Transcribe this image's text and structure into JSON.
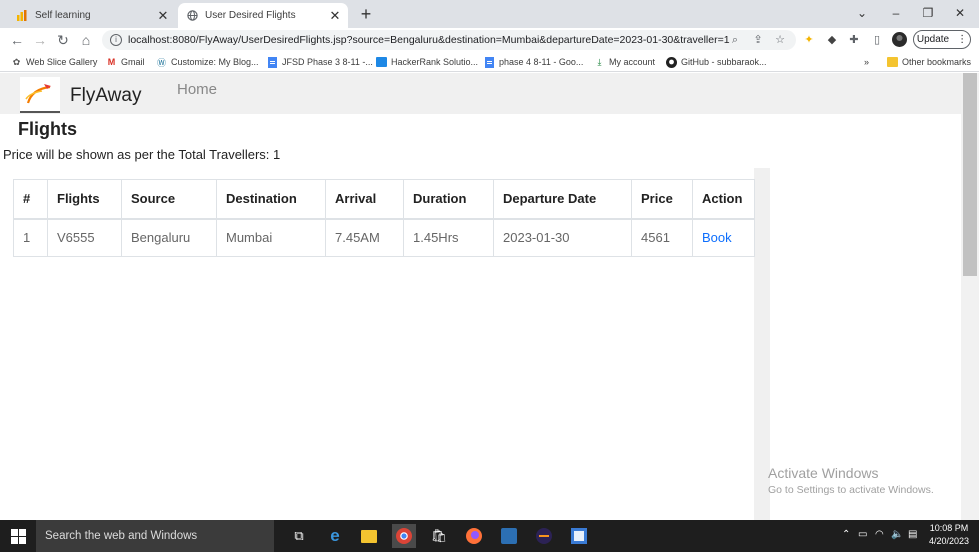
{
  "browser": {
    "tabs": [
      {
        "title": "Self learning",
        "icon": "chart-bars-icon",
        "active": false
      },
      {
        "title": "User Desired Flights",
        "icon": "globe-icon",
        "active": true
      }
    ],
    "new_tab": "+",
    "window_controls": {
      "dropdown": "⌄",
      "minimize": "–",
      "restore": "❐",
      "close": "✕"
    },
    "url": "localhost:8080/FlyAway/UserDesiredFlights.jsp?source=Bengaluru&destination=Mumbai&departureDate=2023-01-30&traveller=1",
    "update_label": "Update",
    "bookmarks": [
      "Web Slice Gallery",
      "Gmail",
      "Customize: My Blog...",
      "JFSD Phase 3 8-11 -...",
      "HackerRank Solutio...",
      "phase 4 8-11 - Goo...",
      "My account",
      "GitHub - subbaraok..."
    ],
    "bookmarks_overflow": "»",
    "other_bookmarks": "Other bookmarks"
  },
  "page": {
    "brand": "FlyAway",
    "nav_home": "Home",
    "heading": "Flights",
    "note": "Price will be shown as per the Total Travellers: 1",
    "table": {
      "headers": [
        "#",
        "Flights",
        "Source",
        "Destination",
        "Arrival",
        "Duration",
        "Departure Date",
        "Price",
        "Action"
      ],
      "rows": [
        [
          "1",
          "V6555",
          "Bengaluru",
          "Mumbai",
          "7.45AM",
          "1.45Hrs",
          "2023-01-30",
          "4561",
          "Book"
        ]
      ]
    }
  },
  "watermark": {
    "line1": "Activate Windows",
    "line2": "Go to Settings to activate Windows."
  },
  "taskbar": {
    "search_placeholder": "Search the web and Windows",
    "time": "10:08 PM",
    "date": "4/20/2023"
  }
}
